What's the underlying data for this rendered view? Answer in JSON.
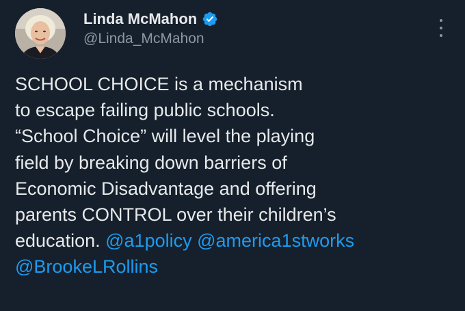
{
  "author": {
    "display_name": "Linda McMahon",
    "handle": "@Linda_McMahon",
    "verified": true,
    "verified_color": "#1d9bf0"
  },
  "menu_icon": "more-vertical-icon",
  "body": {
    "lines": [
      "SCHOOL CHOICE is a mechanism",
      "to escape failing public schools.",
      "“School Choice” will level the playing",
      "field by breaking down barriers of",
      "Economic Disadvantage and offering",
      "parents CONTROL over their children’s",
      "education."
    ],
    "mentions": [
      "@a1policy",
      "@america1stworks",
      "@BrookeLRollins"
    ]
  },
  "colors": {
    "background": "#16202c",
    "text": "#e7e9ea",
    "secondary": "#8b98a5",
    "link": "#1d9bf0"
  }
}
